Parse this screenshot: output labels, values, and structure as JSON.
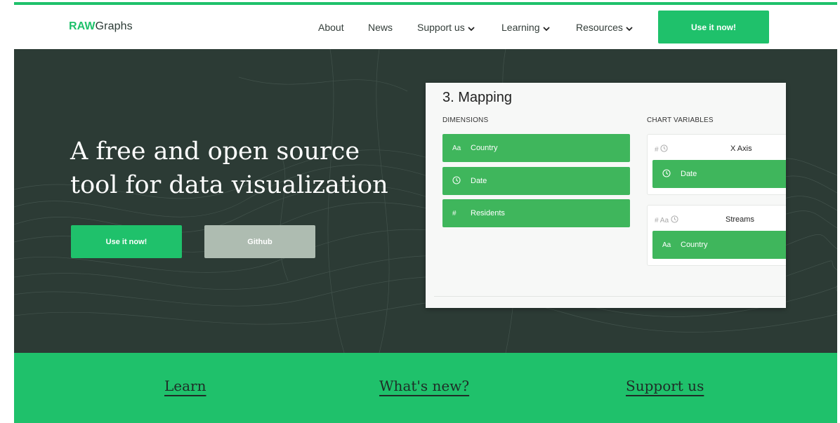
{
  "brand": {
    "bold": "RAW",
    "rest": "Graphs"
  },
  "nav": {
    "about": "About",
    "news": "News",
    "support": "Support us",
    "learning": "Learning",
    "resources": "Resources",
    "cta": "Use it now!"
  },
  "hero": {
    "title": "A free and open source tool for data visualization",
    "primary_button": "Use it now!",
    "secondary_button": "Github"
  },
  "mapping": {
    "title": "3. Mapping",
    "dimensions_label": "DIMENSIONS",
    "variables_label": "CHART VARIABLES",
    "dimensions": [
      {
        "icon": "Aa",
        "label": "Country"
      },
      {
        "icon": "clock-icon",
        "label": "Date"
      },
      {
        "icon": "#",
        "label": "Residents"
      }
    ],
    "variables": [
      {
        "types": "#",
        "name": "X Axis",
        "mapped": "Date"
      },
      {
        "types": "# Aa",
        "name": "Streams",
        "mapped_icon": "Aa",
        "mapped": "Country"
      }
    ]
  },
  "band": {
    "learn": "Learn",
    "whats_new": "What's new?",
    "support": "Support us"
  },
  "colors": {
    "accent": "#1fc16b",
    "hero_bg": "#2c3b35",
    "chip": "#3fb65c",
    "secondary": "#aebcb1"
  }
}
